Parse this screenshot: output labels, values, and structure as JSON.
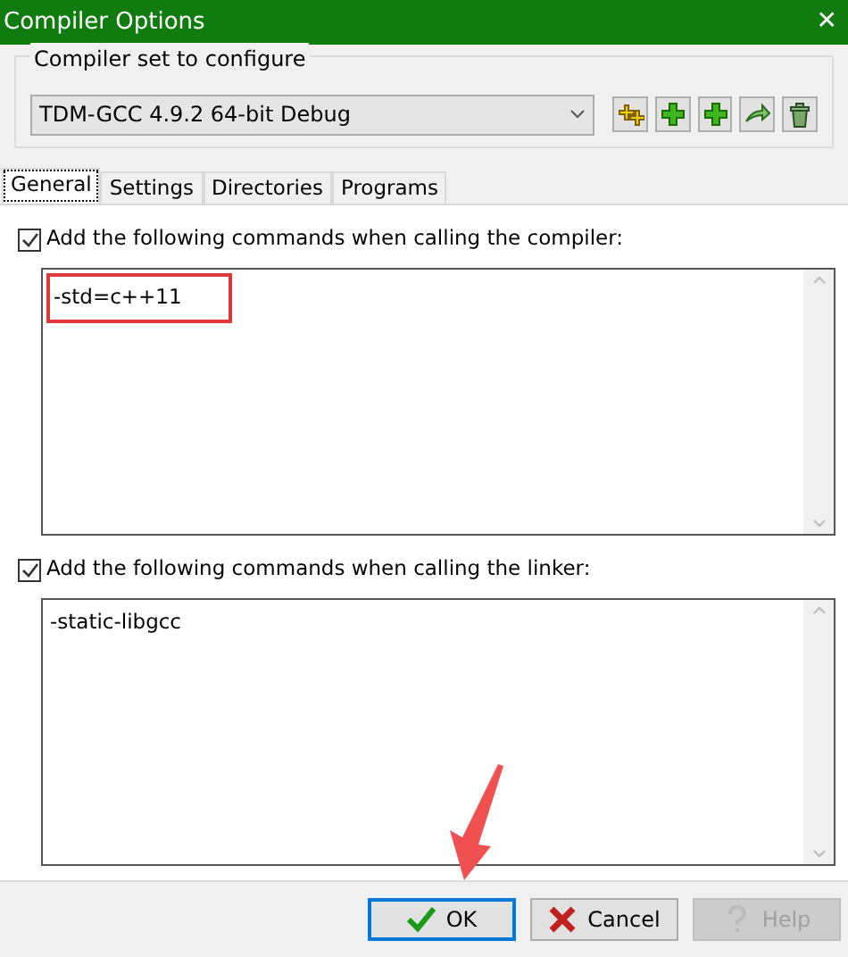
{
  "window": {
    "title": "Compiler Options",
    "close": "✕"
  },
  "compiler_set": {
    "label": "Compiler set to configure",
    "value": "TDM-GCC 4.9.2 64-bit Debug",
    "tools": [
      {
        "kind": "rename"
      },
      {
        "kind": "add"
      },
      {
        "kind": "add"
      },
      {
        "kind": "copy"
      },
      {
        "kind": "delete"
      }
    ]
  },
  "tabs": [
    {
      "label": "General",
      "selected": true
    },
    {
      "label": "Settings",
      "selected": false
    },
    {
      "label": "Directories",
      "selected": false
    },
    {
      "label": "Programs",
      "selected": false
    }
  ],
  "sections": [
    {
      "label": "Add the following commands when calling the compiler:",
      "checked": true,
      "value": "-std=c++11",
      "highlighted": true
    },
    {
      "label": "Add the following commands when calling the linker:",
      "checked": true,
      "value": "-static-libgcc",
      "highlighted": false
    }
  ],
  "buttons": [
    {
      "kind": "ok",
      "label": "OK",
      "disabled": false
    },
    {
      "kind": "cancel",
      "label": "Cancel",
      "disabled": false
    },
    {
      "kind": "help",
      "label": "Help",
      "disabled": true
    }
  ],
  "annotation_arrow": {
    "color": "#f05050"
  }
}
